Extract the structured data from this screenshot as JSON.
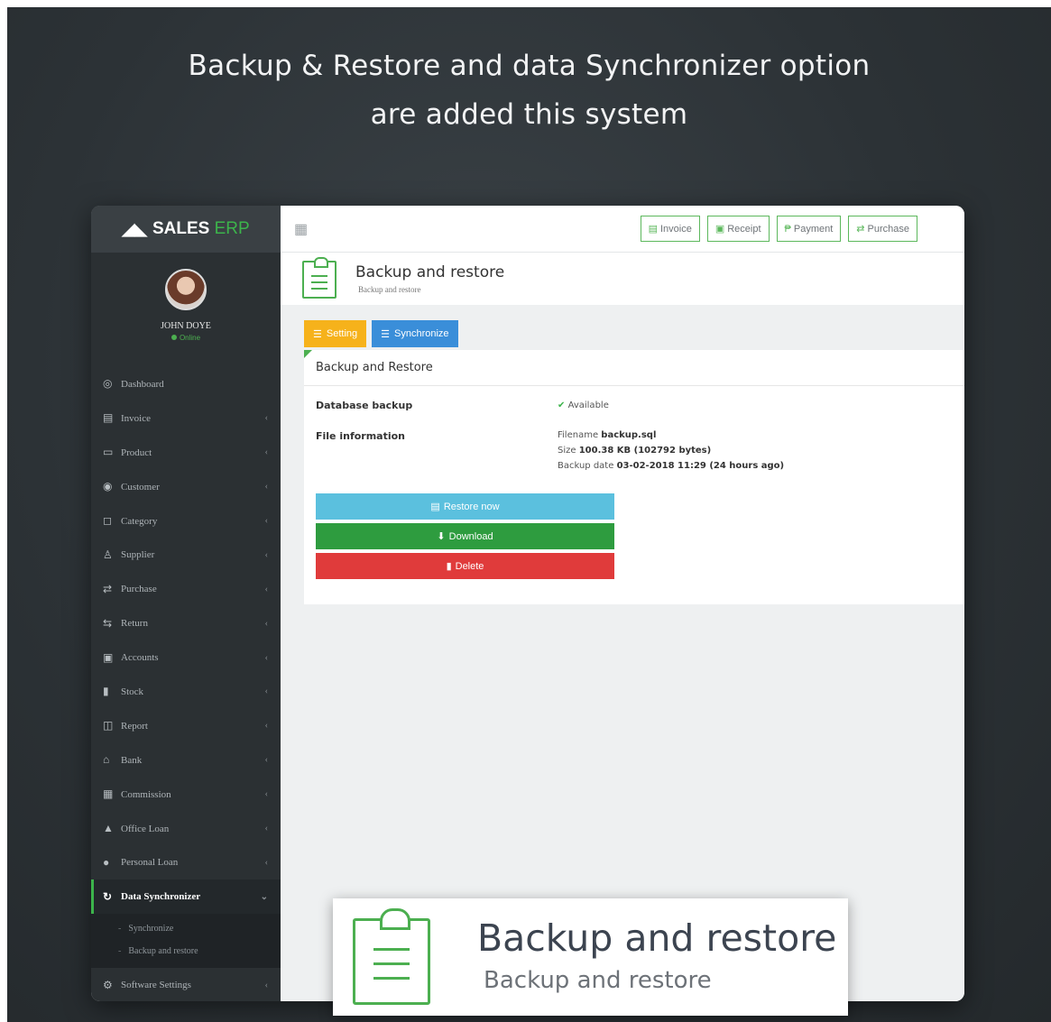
{
  "headline": {
    "line1": "Backup & Restore  and data Synchronizer option",
    "line2": "are added this system"
  },
  "logo": {
    "brand": "SALES",
    "accent": "ERP"
  },
  "user": {
    "name": "JOHN DOYE",
    "status": "Online"
  },
  "sidebar": {
    "items": [
      {
        "label": "Dashboard",
        "icon": "dashboard-icon",
        "glyph": "◎",
        "chevron": ""
      },
      {
        "label": "Invoice",
        "icon": "invoice-icon",
        "glyph": "▤",
        "chevron": "‹"
      },
      {
        "label": "Product",
        "icon": "product-icon",
        "glyph": "▭",
        "chevron": "‹"
      },
      {
        "label": "Customer",
        "icon": "customer-icon",
        "glyph": "◉",
        "chevron": "‹"
      },
      {
        "label": "Category",
        "icon": "category-icon",
        "glyph": "◻",
        "chevron": "‹"
      },
      {
        "label": "Supplier",
        "icon": "supplier-icon",
        "glyph": "♙",
        "chevron": "‹"
      },
      {
        "label": "Purchase",
        "icon": "purchase-icon",
        "glyph": "⇄",
        "chevron": "‹"
      },
      {
        "label": "Return",
        "icon": "return-icon",
        "glyph": "⇆",
        "chevron": "‹"
      },
      {
        "label": "Accounts",
        "icon": "accounts-icon",
        "glyph": "▣",
        "chevron": "‹"
      },
      {
        "label": "Stock",
        "icon": "stock-icon",
        "glyph": "▮",
        "chevron": "‹"
      },
      {
        "label": "Report",
        "icon": "report-icon",
        "glyph": "◫",
        "chevron": "‹"
      },
      {
        "label": "Bank",
        "icon": "bank-icon",
        "glyph": "⌂",
        "chevron": "‹"
      },
      {
        "label": "Commission",
        "icon": "commission-icon",
        "glyph": "▦",
        "chevron": "‹"
      },
      {
        "label": "Office Loan",
        "icon": "office-loan-icon",
        "glyph": "▲",
        "chevron": "‹"
      },
      {
        "label": "Personal Loan",
        "icon": "personal-loan-icon",
        "glyph": "●",
        "chevron": "‹"
      }
    ],
    "active": {
      "label": "Data Synchronizer",
      "icon": "sync-icon",
      "glyph": "↻",
      "chevron": "⌄"
    },
    "subitems": [
      "Synchronize",
      "Backup and restore"
    ],
    "last": {
      "label": "Software Settings",
      "icon": "settings-icon",
      "glyph": "⚙",
      "chevron": "‹"
    }
  },
  "topbar": {
    "buttons": [
      {
        "label": "Invoice",
        "glyph": "▤"
      },
      {
        "label": "Receipt",
        "glyph": "▣"
      },
      {
        "label": "Payment",
        "glyph": "₱"
      },
      {
        "label": "Purchase",
        "glyph": "⇄"
      }
    ]
  },
  "page": {
    "title": "Backup and restore",
    "subtitle": "Backup and restore"
  },
  "tabs": {
    "setting": "Setting",
    "synchronize": "Synchronize"
  },
  "panel": {
    "title": "Backup and Restore",
    "db_label": "Database backup",
    "db_status": "Available",
    "file_label": "File information",
    "filename_label": "Filename",
    "filename_value": "backup.sql",
    "size_label": "Size",
    "size_value": "100.38 KB (102792 bytes)",
    "date_label": "Backup date",
    "date_value": "03-02-2018 11:29 (24 hours ago)"
  },
  "actions": {
    "restore": "Restore now",
    "download": "Download",
    "delete": "Delete"
  },
  "callout": {
    "title": "Backup and restore",
    "subtitle": "Backup and restore"
  },
  "colors": {
    "accent": "#4caf50",
    "restore": "#5bc0de",
    "download": "#2e9c3f",
    "delete": "#e03b3b",
    "setting_tab": "#f6b21b",
    "sync_tab": "#3a8ed9"
  }
}
